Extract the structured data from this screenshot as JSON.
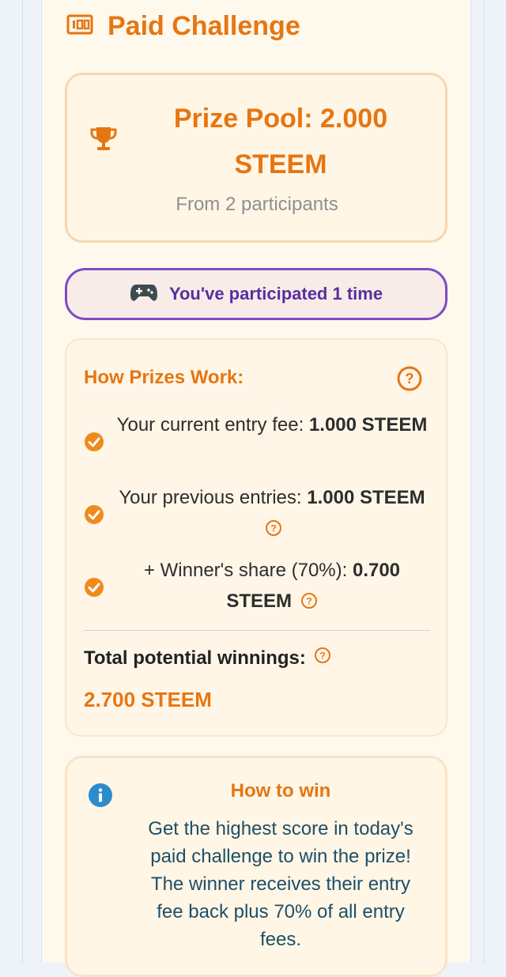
{
  "header": {
    "title": "Paid Challenge",
    "icon": "ticket-icon"
  },
  "prize": {
    "pool_text": "Prize Pool: 2.000 STEEM",
    "participants_text": "From 2 participants",
    "icon": "trophy-icon"
  },
  "participation": {
    "text": "You've participated 1 time",
    "icon": "gamepad-icon"
  },
  "how_prizes": {
    "heading": "How Prizes Work:",
    "rows": [
      {
        "label": "Your current entry fee: ",
        "value": "1.000 STEEM"
      },
      {
        "label": "Your previous entries: ",
        "value": "1.000 STEEM"
      },
      {
        "label": "+ Winner's share (70%): ",
        "value": "0.700 STEEM"
      }
    ],
    "total_label": "Total potential winnings:",
    "total_value": "2.700 STEEM"
  },
  "how_to_win": {
    "title": "How to win",
    "description": "Get the highest score in today's paid challenge to win the prize! The winner receives their entry fee back plus 70% of all entry fees."
  },
  "colors": {
    "accent": "#e67612",
    "purple": "#7d4cc4",
    "info_blue": "#2a8ccf",
    "background": "#fff8ec"
  }
}
